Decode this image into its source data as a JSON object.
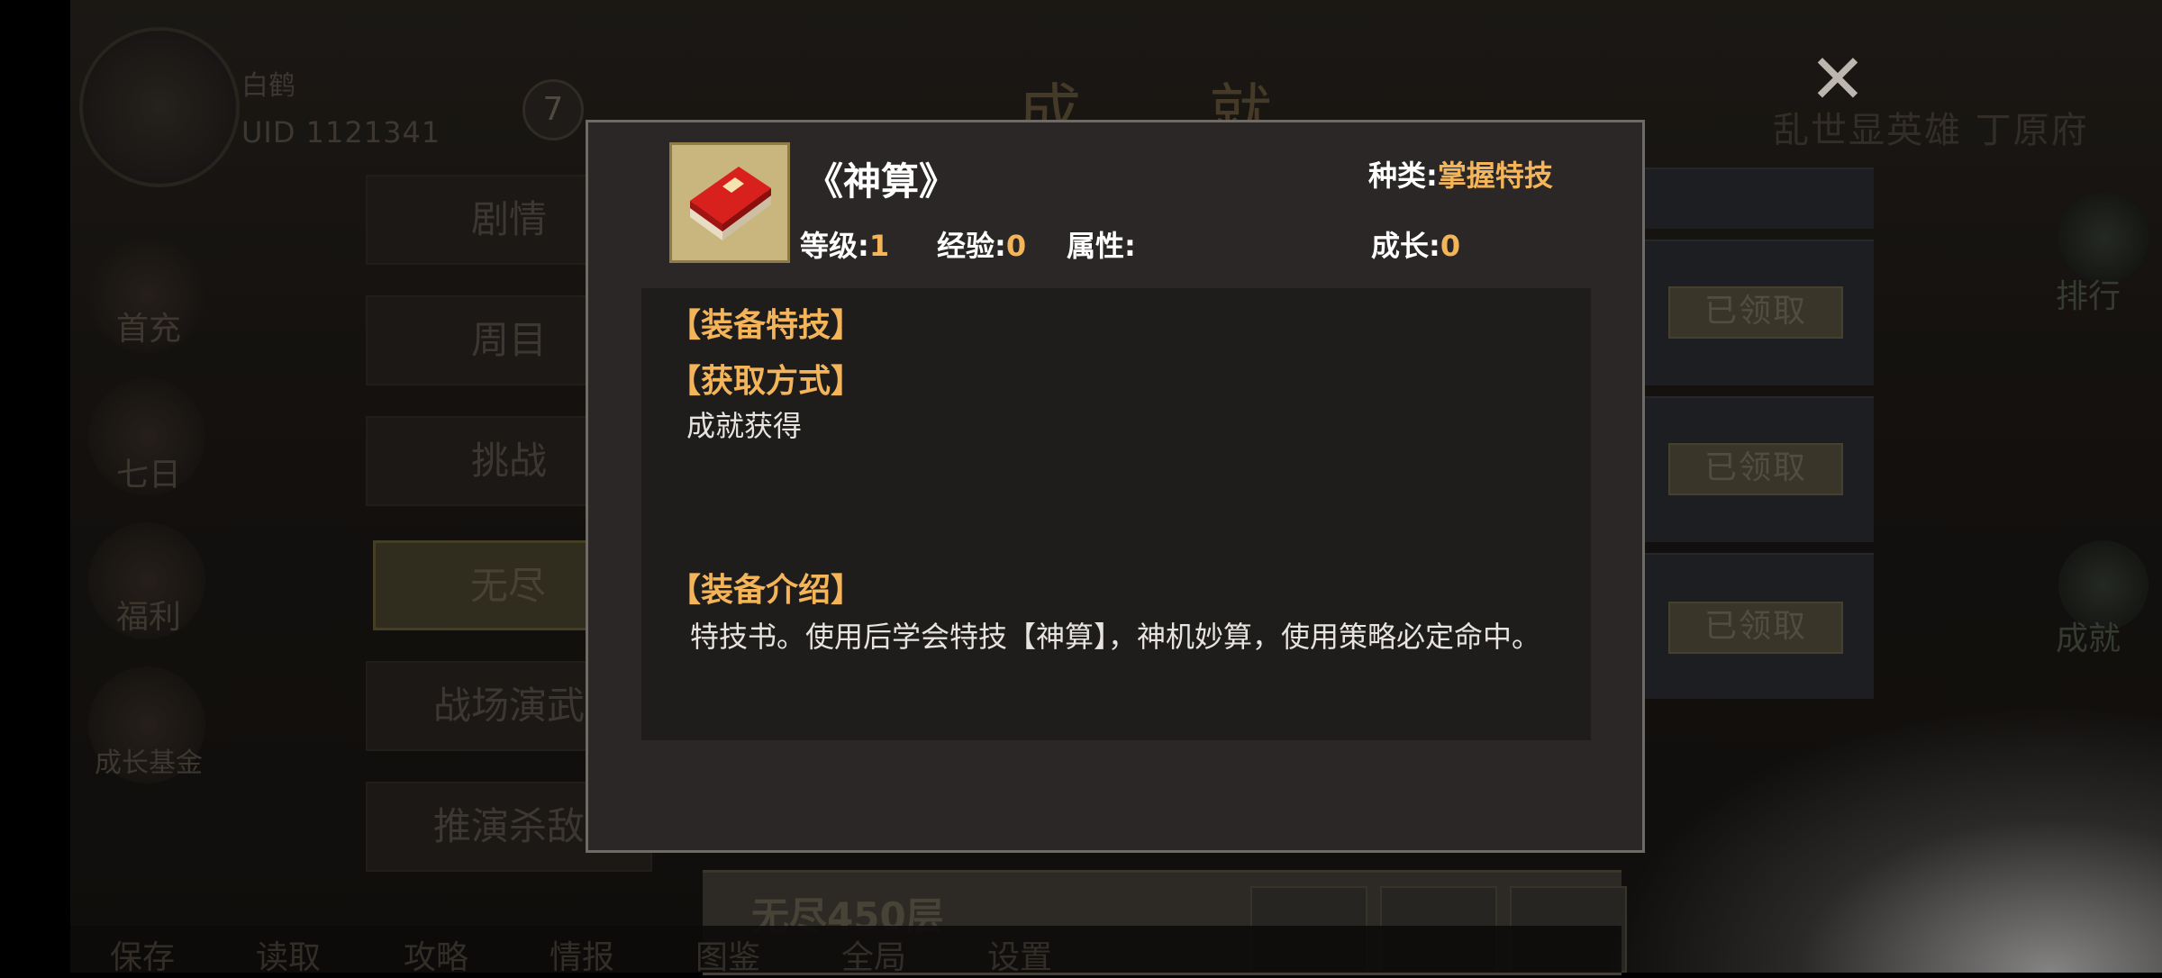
{
  "player": {
    "name": "白鹤",
    "uid": "UID 1121341",
    "level": "7"
  },
  "page_title": "成 就",
  "right_title": "乱世显英雄 丁原府",
  "side_menu": [
    {
      "label": "首充"
    },
    {
      "label": "七日"
    },
    {
      "label": "福利"
    },
    {
      "label": "成长基金"
    }
  ],
  "categories": [
    {
      "label": "剧情"
    },
    {
      "label": "周目"
    },
    {
      "label": "挑战"
    },
    {
      "label": "无尽"
    },
    {
      "label": "战场演武"
    },
    {
      "label": "推演杀敌"
    }
  ],
  "reward_rows": [
    {
      "status": "已领取"
    },
    {
      "status": "已领取"
    },
    {
      "status": "已领取"
    }
  ],
  "bottom_row_label": "无尽450层",
  "bottom_menu": [
    {
      "label": "保存"
    },
    {
      "label": "读取"
    },
    {
      "label": "攻略"
    },
    {
      "label": "情报"
    },
    {
      "label": "图鉴"
    },
    {
      "label": "全局"
    },
    {
      "label": "设置"
    }
  ],
  "right_menu": [
    {
      "label": "排行"
    },
    {
      "label": "成就"
    }
  ],
  "popup": {
    "item_name": "《神算》",
    "kind_label": "种类:",
    "kind_value": "掌握特技",
    "level_label": "等级:",
    "level_value": "1",
    "exp_label": "经验:",
    "exp_value": "0",
    "attr_label": "属性:",
    "attr_value": "",
    "growth_label": "成长:",
    "growth_value": "0",
    "sections": {
      "equip_skill": "【装备特技】",
      "acquire": "【获取方式】",
      "acquire_text": "成就获得",
      "intro": "【装备介绍】",
      "intro_text": "特技书。使用后学会特技【神算】，神机妙算，使用策略必定命中。"
    },
    "icon": "red-book-icon"
  },
  "colors": {
    "accent": "#f3b45a",
    "popup_bg": "#2a2726",
    "panel_bg": "#1f1d1c"
  }
}
